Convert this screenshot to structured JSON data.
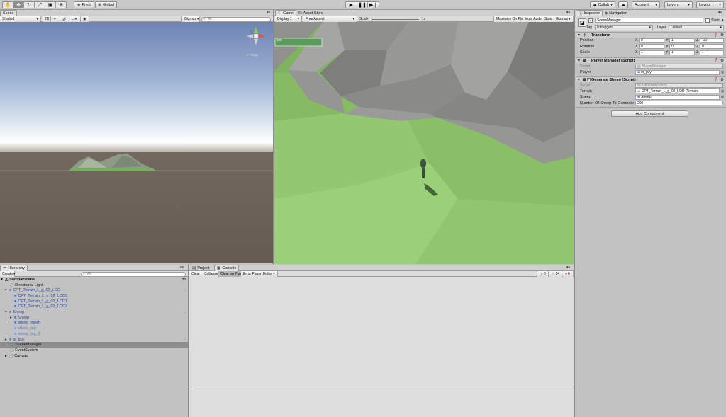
{
  "toolbar": {
    "pivot": "Pivot",
    "global": "Global",
    "collab": "Collab",
    "account": "Account",
    "layers": "Layers",
    "layout": "Layout"
  },
  "scene": {
    "tab": "Scene",
    "shading": "Shaded",
    "mode_2d": "2D",
    "gizmos": "Gizmos",
    "search_placeholder": "All",
    "gizmo_label": "≡ Persp"
  },
  "game": {
    "tab": "Game",
    "asset_store_tab": "Asset Store",
    "display": "Display 1",
    "aspect": "Free Aspect",
    "scale_label": "Scale",
    "scale_value": "1x",
    "maximize": "Maximize On Play",
    "mute": "Mute Audio",
    "stats": "Stats",
    "gizmos": "Gizmos",
    "ui_counter": "200"
  },
  "hierarchy": {
    "tab": "Hierarchy",
    "create": "Create",
    "search_placeholder": "All",
    "scene_name": "SampleScene",
    "items": [
      {
        "label": "Directional Light"
      },
      {
        "label": "CPT_Terrain_L_g_02_LOD"
      },
      {
        "label": "CPT_Terrain_L_g_02_LOD0"
      },
      {
        "label": "CPT_Terrain_L_g_02_LOD1"
      },
      {
        "label": "CPT_Terrain_L_g_02_LOD2"
      },
      {
        "label": "Sheep"
      },
      {
        "label": "Sheep"
      },
      {
        "label": "sheep_mesh"
      },
      {
        "label": "sheep_leg"
      },
      {
        "label": "sheep_leg_2"
      },
      {
        "label": "lp_guy"
      },
      {
        "label": "SceneManager"
      },
      {
        "label": "EventSystem"
      },
      {
        "label": "Canvas"
      }
    ]
  },
  "console": {
    "project_tab": "Project",
    "console_tab": "Console",
    "clear": "Clear",
    "collapse": "Collapse",
    "clear_on_play": "Clear on Play",
    "error_pause": "Error Pause",
    "editor": "Editor",
    "info_count": "0",
    "warn_count": "14",
    "error_count": "0"
  },
  "inspector": {
    "tab": "Inspector",
    "navigation_tab": "Navigation",
    "object_name": "SceneManager",
    "static": "Static",
    "tag_label": "Tag",
    "tag_value": "Untagged",
    "layer_label": "Layer",
    "layer_value": "Default",
    "transform": {
      "title": "Transform",
      "position": "Position",
      "rotation": "Rotation",
      "scale": "Scale",
      "pos": [
        "0",
        "1",
        "-10"
      ],
      "rot": [
        "0",
        "0",
        "0"
      ],
      "scl": [
        "1",
        "1",
        "1"
      ]
    },
    "player_manager": {
      "title": "Player Manager (Script)",
      "script_label": "Script",
      "script_value": "PlayerManager",
      "player_label": "Player",
      "player_value": "lp_guy"
    },
    "generate_sheep": {
      "title": "Generate Sheep (Script)",
      "script_label": "Script",
      "script_value": "GenerateSheep",
      "terrain_label": "Terrain",
      "terrain_value": "CPT_Terrain_L_g_02_LOD (Terrain)",
      "sheep_label": "Sheep",
      "sheep_value": "Sheep",
      "count_label": "Number Of Sheep To Generate",
      "count_value": "200"
    },
    "add_component": "Add Component"
  }
}
